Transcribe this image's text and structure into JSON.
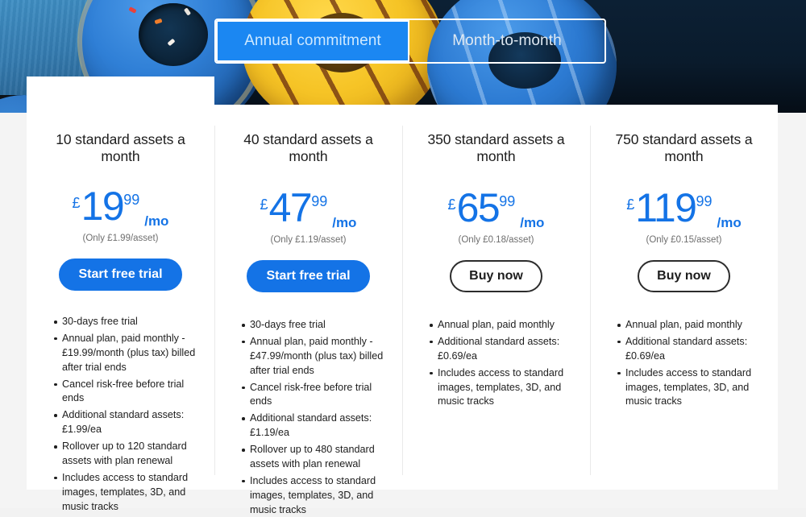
{
  "hero": {
    "alt": "blue and yellow sprinkle donuts on a blue table"
  },
  "toggle": {
    "options": [
      {
        "label": "Annual commitment",
        "selected": true
      },
      {
        "label": "Month-to-month",
        "selected": false
      }
    ],
    "active_color": "#1b87f2",
    "border_color": "#ffffff"
  },
  "accent_color": "#1473e6",
  "plans": [
    {
      "title": "10 standard assets a month",
      "currency": "£",
      "amount": "19",
      "cents": "99",
      "per": "/mo",
      "note": "(Only £1.99/asset)",
      "cta": {
        "label": "Start free trial",
        "style": "primary"
      },
      "features": [
        "30-days free trial",
        "Annual plan, paid monthly - £19.99/month (plus tax) billed after trial ends",
        "Cancel risk-free before trial ends",
        "Additional standard assets: £1.99/ea",
        "Rollover up to 120 standard assets with plan renewal",
        "Includes access to standard images, templates, 3D, and music tracks"
      ]
    },
    {
      "title": "40 standard assets a month",
      "currency": "£",
      "amount": "47",
      "cents": "99",
      "per": "/mo",
      "note": "(Only £1.19/asset)",
      "cta": {
        "label": "Start free trial",
        "style": "primary"
      },
      "features": [
        "30-days free trial",
        "Annual plan, paid monthly - £47.99/month (plus tax) billed after trial ends",
        "Cancel risk-free before trial ends",
        "Additional standard assets: £1.19/ea",
        "Rollover up to 480 standard assets with plan renewal",
        "Includes access to standard images, templates, 3D, and music tracks"
      ]
    },
    {
      "title": "350 standard assets a month",
      "currency": "£",
      "amount": "65",
      "cents": "99",
      "per": "/mo",
      "note": "(Only £0.18/asset)",
      "cta": {
        "label": "Buy now",
        "style": "secondary"
      },
      "features": [
        "Annual plan, paid monthly",
        "Additional standard assets: £0.69/ea",
        "Includes access to standard images, templates, 3D, and music tracks"
      ]
    },
    {
      "title": "750 standard assets a month",
      "currency": "£",
      "amount": "119",
      "cents": "99",
      "per": "/mo",
      "note": "(Only £0.15/asset)",
      "cta": {
        "label": "Buy now",
        "style": "secondary"
      },
      "features": [
        "Annual plan, paid monthly",
        "Additional standard assets: £0.69/ea",
        "Includes access to standard images, templates, 3D, and music tracks"
      ]
    }
  ]
}
